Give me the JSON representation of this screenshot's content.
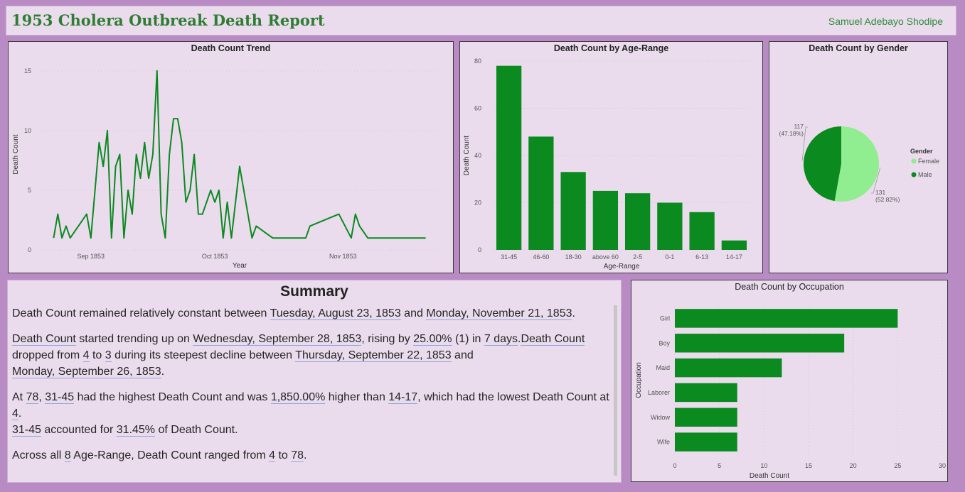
{
  "header": {
    "title": "1953 Cholera Outbreak Death Report",
    "author": "Samuel Adebayo Shodipe"
  },
  "colors": {
    "primary": "#0a8a1f",
    "light_green": "#90ee90",
    "background": "#b98bc4",
    "panel": "#eadcec"
  },
  "trend": {
    "chart_data": {
      "type": "line",
      "title": "Death Count Trend",
      "xlabel": "Year",
      "ylabel": "Death Count",
      "ylim": [
        0,
        16
      ],
      "yticks": [
        0,
        5,
        10,
        15
      ],
      "xticks": [
        {
          "date": "1853-09-01",
          "label": "Sep 1853"
        },
        {
          "date": "1853-10-01",
          "label": "Oct 1853"
        },
        {
          "date": "1853-11-01",
          "label": "Nov 1853"
        }
      ],
      "series": [
        {
          "points": [
            {
              "x": "1853-08-23",
              "y": 1
            },
            {
              "x": "1853-08-24",
              "y": 3
            },
            {
              "x": "1853-08-25",
              "y": 1
            },
            {
              "x": "1853-08-26",
              "y": 2
            },
            {
              "x": "1853-08-27",
              "y": 1
            },
            {
              "x": "1853-08-31",
              "y": 3
            },
            {
              "x": "1853-09-01",
              "y": 1
            },
            {
              "x": "1853-09-03",
              "y": 9
            },
            {
              "x": "1853-09-04",
              "y": 7
            },
            {
              "x": "1853-09-05",
              "y": 10
            },
            {
              "x": "1853-09-06",
              "y": 1
            },
            {
              "x": "1853-09-07",
              "y": 7
            },
            {
              "x": "1853-09-08",
              "y": 8
            },
            {
              "x": "1853-09-09",
              "y": 1
            },
            {
              "x": "1853-09-10",
              "y": 5
            },
            {
              "x": "1853-09-11",
              "y": 3
            },
            {
              "x": "1853-09-12",
              "y": 8
            },
            {
              "x": "1853-09-13",
              "y": 6
            },
            {
              "x": "1853-09-14",
              "y": 9
            },
            {
              "x": "1853-09-15",
              "y": 6
            },
            {
              "x": "1853-09-16",
              "y": 8
            },
            {
              "x": "1853-09-17",
              "y": 15
            },
            {
              "x": "1853-09-18",
              "y": 3
            },
            {
              "x": "1853-09-19",
              "y": 1
            },
            {
              "x": "1853-09-20",
              "y": 8
            },
            {
              "x": "1853-09-21",
              "y": 11
            },
            {
              "x": "1853-09-22",
              "y": 11
            },
            {
              "x": "1853-09-23",
              "y": 9
            },
            {
              "x": "1853-09-24",
              "y": 4
            },
            {
              "x": "1853-09-25",
              "y": 5
            },
            {
              "x": "1853-09-26",
              "y": 8
            },
            {
              "x": "1853-09-27",
              "y": 3
            },
            {
              "x": "1853-09-28",
              "y": 3
            },
            {
              "x": "1853-09-30",
              "y": 5
            },
            {
              "x": "1853-10-01",
              "y": 4
            },
            {
              "x": "1853-10-02",
              "y": 5
            },
            {
              "x": "1853-10-03",
              "y": 1
            },
            {
              "x": "1853-10-04",
              "y": 4
            },
            {
              "x": "1853-10-05",
              "y": 1
            },
            {
              "x": "1853-10-07",
              "y": 7
            },
            {
              "x": "1853-10-10",
              "y": 1
            },
            {
              "x": "1853-10-11",
              "y": 2
            },
            {
              "x": "1853-10-15",
              "y": 1
            },
            {
              "x": "1853-10-23",
              "y": 1
            },
            {
              "x": "1853-10-24",
              "y": 2
            },
            {
              "x": "1853-10-31",
              "y": 3
            },
            {
              "x": "1853-11-03",
              "y": 1
            },
            {
              "x": "1853-11-04",
              "y": 3
            },
            {
              "x": "1853-11-05",
              "y": 2
            },
            {
              "x": "1853-11-07",
              "y": 1
            },
            {
              "x": "1853-11-21",
              "y": 1
            }
          ]
        }
      ]
    }
  },
  "age": {
    "chart_data": {
      "type": "bar",
      "title": "Death Count by Age-Range",
      "xlabel": "Age-Range",
      "ylabel": "Death Count",
      "ylim": [
        0,
        80
      ],
      "yticks": [
        0,
        20,
        40,
        60,
        80
      ],
      "categories": [
        "31-45",
        "46-60",
        "18-30",
        "above 60",
        "2-5",
        "0-1",
        "6-13",
        "14-17"
      ],
      "values": [
        78,
        48,
        33,
        25,
        24,
        20,
        16,
        4
      ]
    }
  },
  "gender": {
    "chart_data": {
      "type": "pie",
      "title": "Death Count by Gender",
      "legend_title": "Gender",
      "legend_position": "right",
      "slices": [
        {
          "label": "Female",
          "value": 131,
          "value_label": "131",
          "pct_label": "(52.82%)",
          "color": "#90ee90"
        },
        {
          "label": "Male",
          "value": 117,
          "value_label": "117",
          "pct_label": "(47.18%)",
          "color": "#0a8a1f"
        }
      ]
    }
  },
  "occupation": {
    "chart_data": {
      "type": "bar",
      "orientation": "horizontal",
      "title": "Death Count by Occupation",
      "xlabel": "Death Count",
      "ylabel": "Occupation",
      "xlim": [
        0,
        30
      ],
      "xticks": [
        0,
        5,
        10,
        15,
        20,
        25,
        30
      ],
      "categories": [
        "Girl",
        "Boy",
        "Maid",
        "Laborer",
        "Widow",
        "Wife"
      ],
      "values": [
        25,
        19,
        12,
        7,
        7,
        7
      ]
    }
  },
  "summary": {
    "title": "Summary",
    "paragraphs": [
      [
        {
          "t": "Death Count remained relatively constant between "
        },
        {
          "t": "Tuesday, August 23, 1853",
          "u": true
        },
        {
          "t": " and "
        },
        {
          "t": "Monday, November 21, 1853",
          "u": true
        },
        {
          "t": "."
        }
      ],
      [
        {
          "t": "Death Count",
          "u": true
        },
        {
          "t": " started trending up on "
        },
        {
          "t": "Wednesday, September 28, 1853",
          "u": true
        },
        {
          "t": ", rising by "
        },
        {
          "t": "25.00%",
          "u": true
        },
        {
          "t": " (1) in "
        },
        {
          "t": "7 days",
          "u": true
        },
        {
          "t": "."
        },
        {
          "t": "Death Count",
          "u": true
        },
        {
          "t": " dropped from "
        },
        {
          "t": "4",
          "u": true
        },
        {
          "t": " to "
        },
        {
          "t": "3",
          "u": true
        },
        {
          "t": " during its steepest decline between "
        },
        {
          "t": "Thursday, September 22, 1853",
          "u": true
        },
        {
          "t": " and "
        },
        {
          "br": true
        },
        {
          "t": "Monday, September 26, 1853",
          "u": true
        },
        {
          "t": "."
        }
      ],
      [
        {
          "t": "At "
        },
        {
          "t": "78",
          "u": true
        },
        {
          "t": ", "
        },
        {
          "t": "31-45",
          "u": true
        },
        {
          "t": " had the highest Death Count and was "
        },
        {
          "t": "1,850.00%",
          "u": true
        },
        {
          "t": " higher than "
        },
        {
          "t": "14-17",
          "u": true
        },
        {
          "t": ", which had the lowest Death Count at "
        },
        {
          "t": "4",
          "u": true
        },
        {
          "t": "."
        },
        {
          "br": true
        },
        {
          "t": "31-45",
          "u": true
        },
        {
          "t": " accounted for "
        },
        {
          "t": "31.45%",
          "u": true
        },
        {
          "t": " of Death Count."
        }
      ],
      [
        {
          "t": "Across all "
        },
        {
          "t": "8",
          "u": true
        },
        {
          "t": " Age-Range, Death Count ranged from "
        },
        {
          "t": "4",
          "u": true
        },
        {
          "t": " to "
        },
        {
          "t": "78",
          "u": true
        },
        {
          "t": "."
        }
      ]
    ]
  }
}
